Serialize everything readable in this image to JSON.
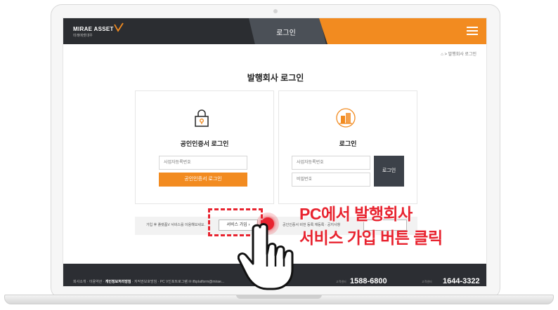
{
  "header": {
    "logo_text": "MIRAE ASSET",
    "logo_sub": "미래에셋대우",
    "nav_label": "로그인",
    "menu_icon": "hamburger-icon",
    "accent_color": "#f28b20",
    "dark_color": "#2b2d31"
  },
  "breadcrumb": {
    "home_icon": "home-icon",
    "current": "발행회사 로그인"
  },
  "page_title": "발행회사 로그인",
  "cert_panel": {
    "icon": "lock-icon",
    "title": "공인인증서 로그인",
    "field_placeholder": "사업자등록번호",
    "button_label": "공인인증서 로그인"
  },
  "login_panel": {
    "icon": "building-icon",
    "title": "로그인",
    "id_placeholder": "사업자등록번호",
    "pw_placeholder": "비밀번호",
    "button_label": "로그인"
  },
  "join_row": {
    "text": "가입 후 플랫폼V 서비스를 이용해보세요.",
    "join_button": "서비스 가입",
    "text2": "공인인증서 비번 등록 재등록 · 공지사항",
    "button2": ""
  },
  "footer": {
    "links": [
      "회사소개",
      "이용약관"
    ],
    "links_bold": "개인정보처리방침",
    "links2": [
      "저작권보호방침",
      "PC V인포트로그램"
    ],
    "email": "ifbplatform@mirae...",
    "phone_label1": "고객센터",
    "phone1": "1588-6800",
    "phone_label2": "고객센터",
    "phone2": "1644-3322"
  },
  "annotation": {
    "line1": "PC에서 발행회사",
    "line2": "서비스 가입 버튼 클릭",
    "color": "#e8232f"
  }
}
